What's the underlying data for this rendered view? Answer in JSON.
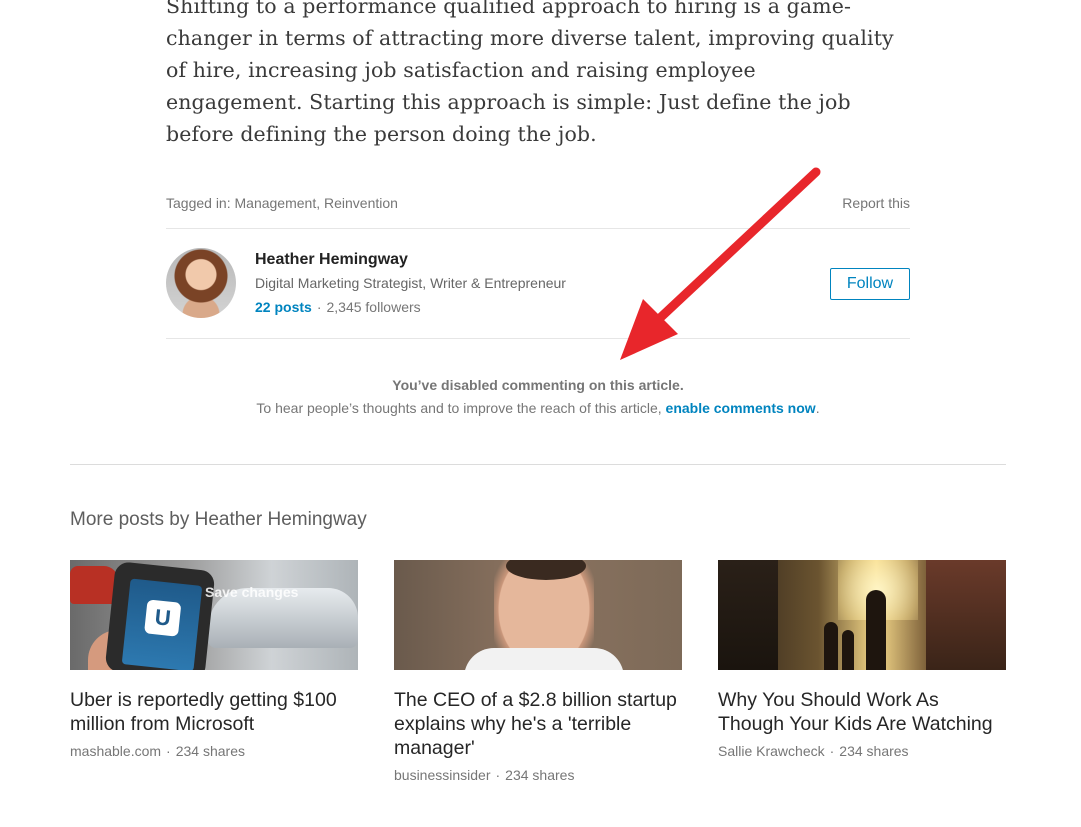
{
  "article": {
    "body_text": "Shifting to a performance qualified approach to hiring is a game-changer in terms of attracting more diverse talent, improving quality of hire, increasing job satisfaction and raising employee engagement. Starting this approach is simple: Just define the job before defining the person doing the job."
  },
  "tags": {
    "label": "Tagged in: Management, Reinvention",
    "report_label": "Report this"
  },
  "author": {
    "name": "Heather Hemingway",
    "headline": "Digital Marketing Strategist, Writer & Entrepreneur",
    "posts": "22 posts",
    "separator": "·",
    "followers": "2,345 followers",
    "follow_label": "Follow"
  },
  "comments": {
    "disabled_text": "You’ve disabled commenting on this article.",
    "hint_text": "To hear people’s thoughts and to improve the reach of this article, ",
    "enable_link": "enable comments now",
    "period": "."
  },
  "more_posts": {
    "title": "More posts by Heather Hemingway",
    "cards": [
      {
        "title": "Uber is reportedly getting $100 million from Microsoft",
        "source": "mashable.com",
        "separator": "·",
        "shares": "234 shares",
        "overlay_text": "Save changes",
        "logo_letter": "U"
      },
      {
        "title": "The CEO of a $2.8 billion startup explains why he's a 'terrible manager'",
        "source": "businessinsider",
        "separator": "·",
        "shares": "234 shares"
      },
      {
        "title": "Why You Should Work As Though Your Kids Are Watching",
        "source": "Sallie Krawcheck",
        "separator": "·",
        "shares": "234 shares"
      }
    ]
  },
  "colors": {
    "link_blue": "#0084bf",
    "annotation_arrow": "#e8262b"
  }
}
